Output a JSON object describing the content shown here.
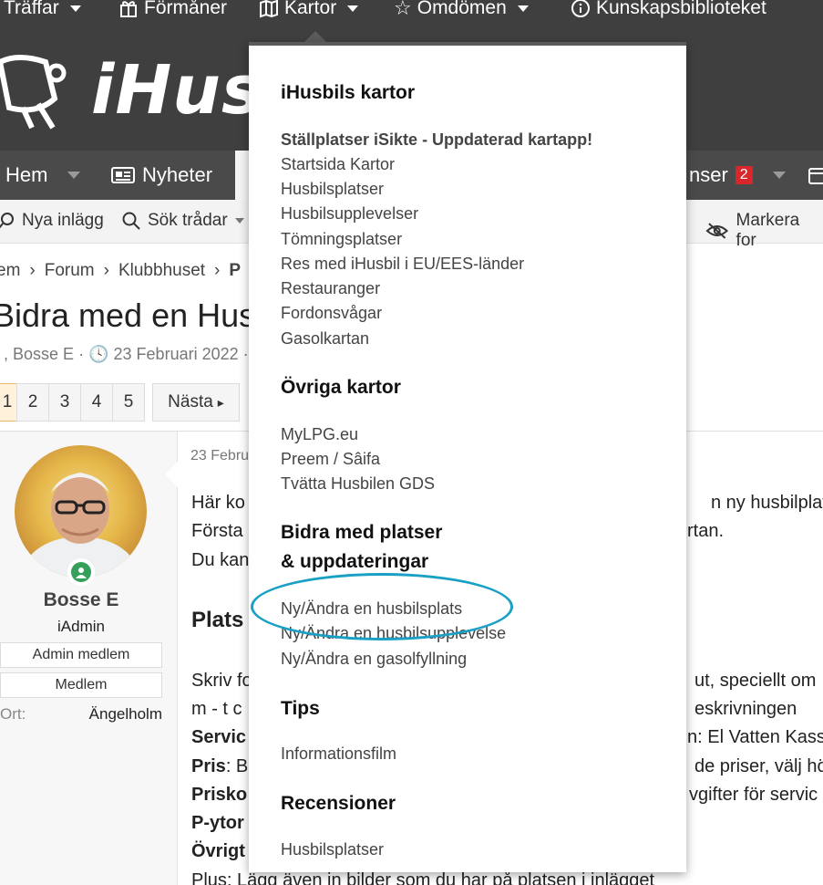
{
  "topnav": [
    {
      "label": "Träffar",
      "icon": "caret"
    },
    {
      "label": "Förmåner",
      "icon": "gift-icon"
    },
    {
      "label": "Kartor",
      "icon": "map-icon"
    },
    {
      "label": "Omdömen",
      "icon": "star-icon"
    },
    {
      "label": "Kunskapsbiblioteket",
      "icon": "info-icon"
    }
  ],
  "logo": {
    "text": "iHusb"
  },
  "mainnav": {
    "home": "Hem",
    "news": "Nyheter",
    "reviews_partial": "nser",
    "reviews_badge": "2"
  },
  "subnav": {
    "new_posts": "Nya inlägg",
    "search_threads": "Sök trådar",
    "mark_read": "Markera for"
  },
  "breadcrumb": [
    "em",
    "Forum",
    "Klubbhuset",
    "P"
  ],
  "thread": {
    "title": "Bidra med en Husb",
    "author": "Bosse E",
    "date": "23 Februari 2022"
  },
  "pager": {
    "pages": [
      "1",
      "2",
      "3",
      "4",
      "5"
    ],
    "next": "Nästa"
  },
  "user": {
    "name": "Bosse E",
    "role": "iAdmin",
    "badge1": "Admin medlem",
    "badge2": "Medlem",
    "ort_label": "Ort:",
    "ort_value": "Ängelholm"
  },
  "post": {
    "date": "23 Febru",
    "l1a": "Här ko",
    "l1b": "n ny husbilplats",
    "l2a": "Första",
    "l2b": "rtan.",
    "l3": "Du kan",
    "h": "Plats",
    "l4a": "Skriv fo",
    "l4b": "ut, speciellt om",
    "l5a": "m - t c",
    "l5b": "eskrivningen",
    "l6a": "Servic",
    "l6b": "n: El Vatten Kass",
    "l7a": "Pris",
    "l7b": ": B",
    "l7c": "de priser, välj hö",
    "l8a": "Prisko",
    "l8b": "vgifter för servic",
    "l9": "P-ytor",
    "l10": "Övrigt",
    "l11": "Plus: Lägg även in bilder som du har på platsen i inlägget"
  },
  "menu": {
    "h1": "iHusbils kartor",
    "items1": [
      "Ställplatser iSikte - Uppdaterad kartapp!",
      "Startsida Kartor",
      "Husbilsplatser",
      "Husbilsupplevelser",
      "Tömningsplatser",
      "Res med iHusbil i EU/EES-länder",
      "Restauranger",
      "Fordonsvågar",
      "Gasolkartan"
    ],
    "h2": "Övriga kartor",
    "items2": [
      "MyLPG.eu",
      "Preem / Sâifa",
      "Tvätta Husbilen GDS"
    ],
    "h3a": "Bidra med platser",
    "h3b": "& uppdateringar",
    "items3": [
      "Ny/Ändra en husbilsplats",
      "Ny/Ändra en husbilsupplevelse",
      "Ny/Ändra en gasolfyllning"
    ],
    "h4": "Tips",
    "items4": [
      "Informationsfilm"
    ],
    "h5": "Recensioner",
    "items5": [
      "Husbilsplatser"
    ]
  },
  "colors": {
    "highlight_ring": "#1a9fc5",
    "header_bg": "#3f3f3f",
    "badge_red": "#d8262b"
  }
}
